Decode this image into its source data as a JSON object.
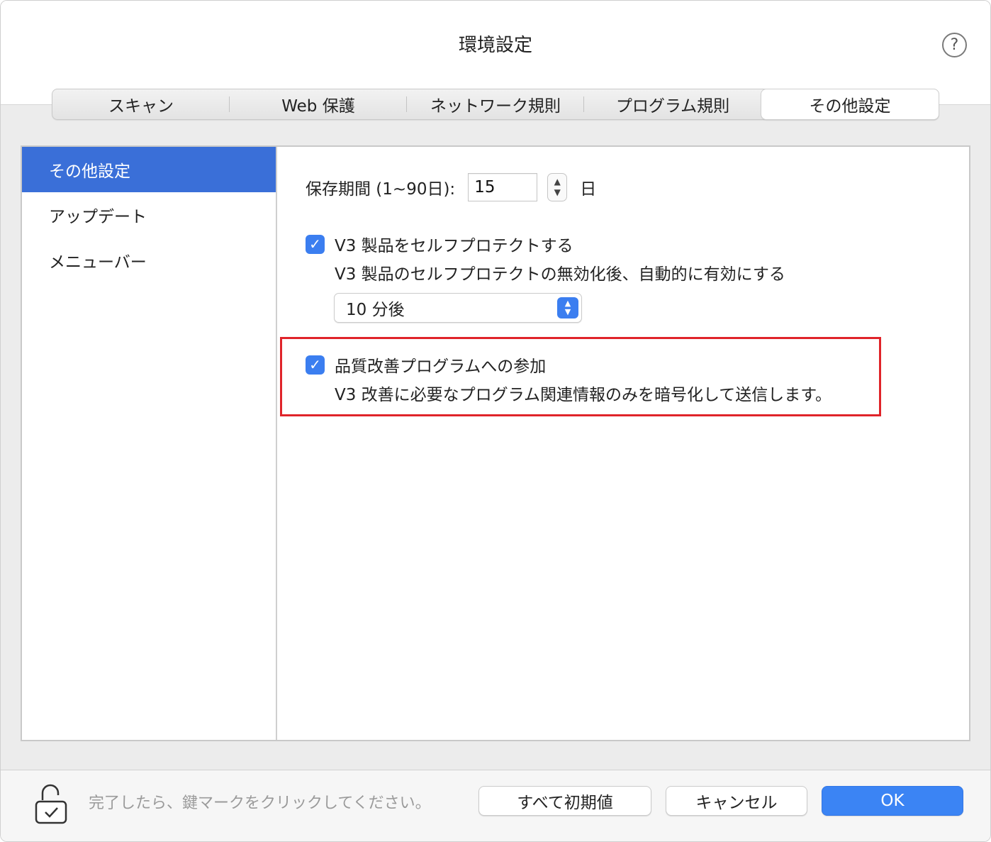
{
  "window": {
    "title": "環境設定",
    "help_glyph": "?"
  },
  "tabs": [
    {
      "label": "スキャン",
      "active": false
    },
    {
      "label": "Web 保護",
      "active": false
    },
    {
      "label": "ネットワーク規則",
      "active": false
    },
    {
      "label": "プログラム規則",
      "active": false
    },
    {
      "label": "その他設定",
      "active": true
    }
  ],
  "sidebar": {
    "items": [
      {
        "label": "その他設定",
        "selected": true
      },
      {
        "label": "アップデート",
        "selected": false
      },
      {
        "label": "メニューバー",
        "selected": false
      }
    ]
  },
  "settings": {
    "retention_label": "保存期間 (1~90日):",
    "retention_value": "15",
    "retention_unit": "日",
    "self_protect_label": "V3 製品をセルフプロテクトする",
    "self_protect_checked": true,
    "self_protect_desc": "V3 製品のセルフプロテクトの無効化後、自動的に有効にする",
    "reenable_selected": "10 分後",
    "quality_label": "品質改善プログラムへの参加",
    "quality_checked": true,
    "quality_desc": "V3 改善に必要なプログラム関連情報のみを暗号化して送信します。"
  },
  "footer": {
    "hint": "完了したら、鍵マークをクリックしてください。",
    "reset_label": "すべて初期値",
    "cancel_label": "キャンセル",
    "ok_label": "OK"
  },
  "colors": {
    "accent": "#3b7ef0",
    "sidebar_selected": "#3a6fd8",
    "highlight_border": "#e0242a"
  }
}
